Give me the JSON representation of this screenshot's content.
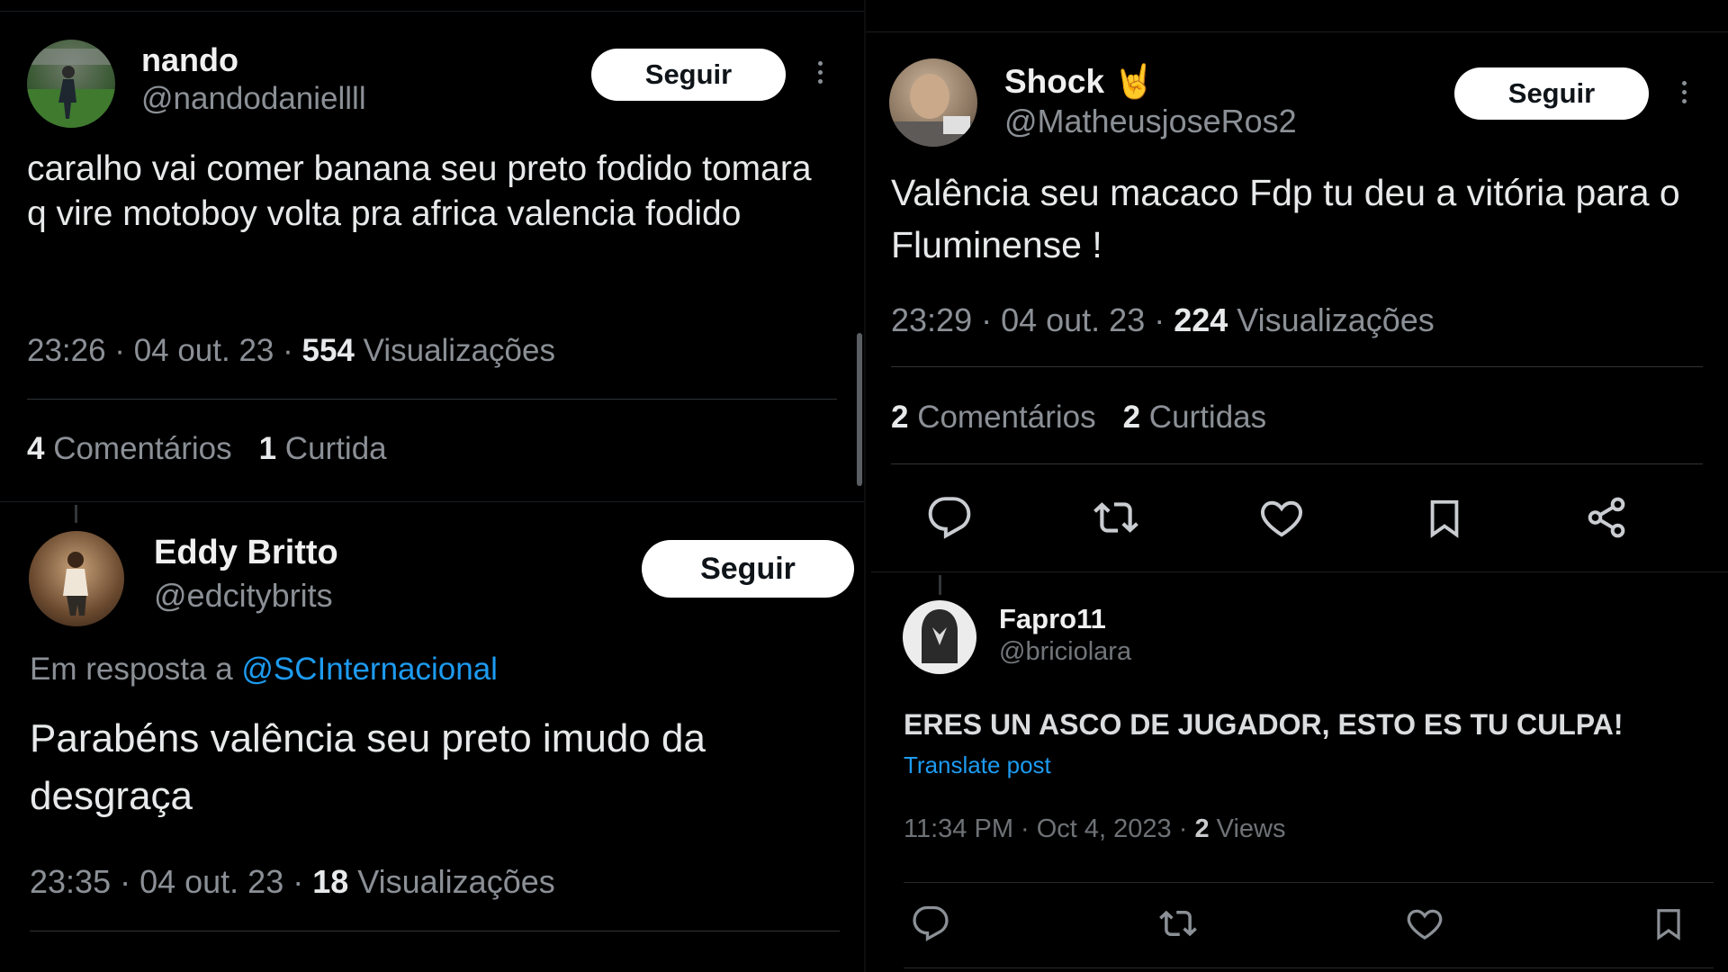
{
  "colors": {
    "background": "#000000",
    "text": "#e7e9ea",
    "muted": "#8b9096",
    "link": "#1d9bf0",
    "button": "#ffffff"
  },
  "post1": {
    "name": "nando",
    "handle": "@nandodaniellll",
    "follow_label": "Seguir",
    "text": "caralho vai comer banana seu preto fodido tomara q vire motoboy volta pra africa valencia fodido",
    "time": "23:26 · 04 out. 23 · ",
    "views_count": "554",
    "views_label": " Visualizações",
    "comments_count": "4",
    "comments_label": " Comentários",
    "likes_count": "1",
    "likes_label": " Curtida"
  },
  "post2": {
    "name": "Eddy Britto",
    "handle": "@edcitybrits",
    "follow_label": "Seguir",
    "reply_prefix": "Em resposta a ",
    "reply_to": "@SCInternacional",
    "text": "Parabéns valência seu preto imudo da desgraça",
    "time": "23:35 · 04 out. 23 · ",
    "views_count": "18",
    "views_label": " Visualizações"
  },
  "post3": {
    "name": "Shock",
    "name_emoji": "🤘",
    "handle": "@MatheusjoseRos2",
    "follow_label": "Seguir",
    "text": "Valência seu macaco Fdp tu deu a vitória para o Fluminense !",
    "time": "23:29 · 04 out. 23 · ",
    "views_count": "224",
    "views_label": " Visualizações",
    "comments_count": "2",
    "comments_label": " Comentários",
    "likes_count": "2",
    "likes_label": " Curtidas",
    "actions": [
      "reply-icon",
      "retweet-icon",
      "like-icon",
      "bookmark-icon",
      "share-icon"
    ]
  },
  "post4": {
    "name": "Fapro11",
    "handle": "@briciolara",
    "text": "ERES UN ASCO DE JUGADOR, ESTO ES TU CULPA!",
    "translate": "Translate post",
    "time": "11:34 PM · Oct 4, 2023 · ",
    "views_count": "2",
    "views_label": " Views",
    "actions": [
      "reply-icon",
      "retweet-icon",
      "like-icon",
      "bookmark-icon"
    ]
  }
}
